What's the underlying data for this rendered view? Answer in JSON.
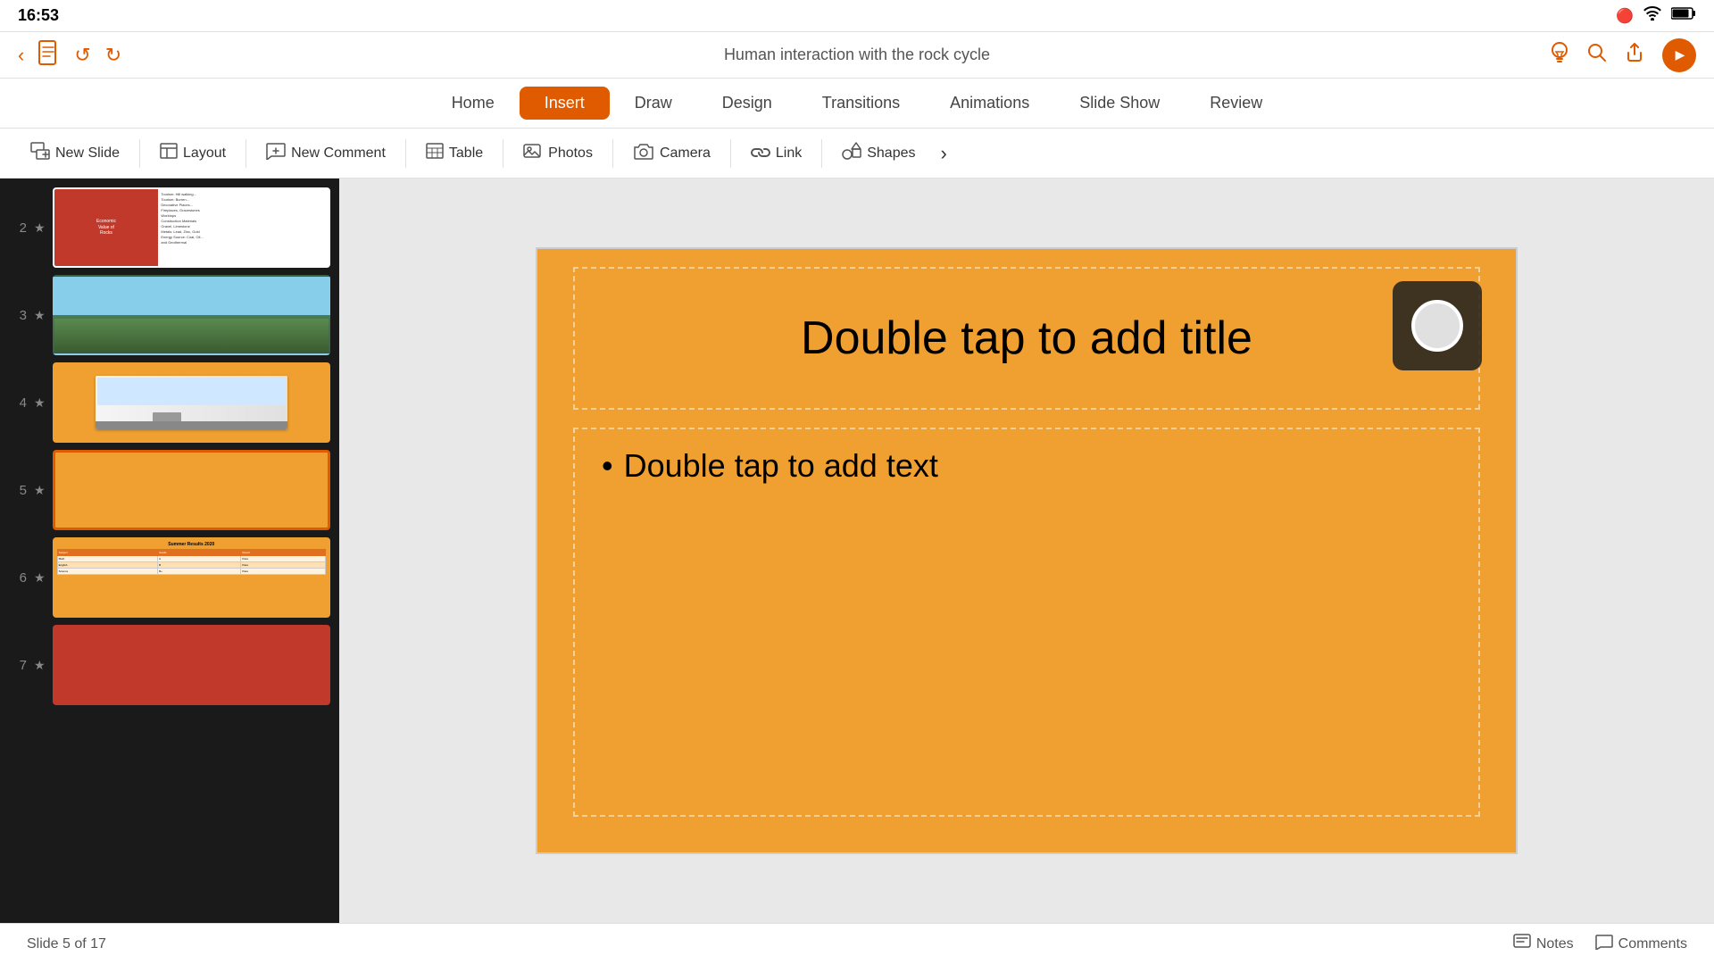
{
  "statusBar": {
    "time": "16:53",
    "icons": [
      "record",
      "wifi",
      "battery"
    ]
  },
  "titleBar": {
    "title": "Human interaction with the rock cycle"
  },
  "tabs": [
    {
      "label": "Home",
      "active": false
    },
    {
      "label": "Insert",
      "active": true
    },
    {
      "label": "Draw",
      "active": false
    },
    {
      "label": "Design",
      "active": false
    },
    {
      "label": "Transitions",
      "active": false
    },
    {
      "label": "Animations",
      "active": false
    },
    {
      "label": "Slide Show",
      "active": false
    },
    {
      "label": "Review",
      "active": false
    }
  ],
  "toolbar": [
    {
      "label": "New Slide",
      "icon": "new-slide"
    },
    {
      "label": "Layout",
      "icon": "layout"
    },
    {
      "label": "New Comment",
      "icon": "new-comment"
    },
    {
      "label": "Table",
      "icon": "table"
    },
    {
      "label": "Photos",
      "icon": "photos"
    },
    {
      "label": "Camera",
      "icon": "camera"
    },
    {
      "label": "Link",
      "icon": "link"
    },
    {
      "label": "Shapes",
      "icon": "shapes"
    }
  ],
  "slides": [
    {
      "number": "2",
      "star": true,
      "type": "content"
    },
    {
      "number": "3",
      "star": true,
      "type": "photo"
    },
    {
      "number": "4",
      "star": true,
      "type": "laptop"
    },
    {
      "number": "5",
      "star": true,
      "type": "blank",
      "active": true
    },
    {
      "number": "6",
      "star": true,
      "type": "table"
    },
    {
      "number": "7",
      "star": true,
      "type": "red"
    }
  ],
  "currentSlide": {
    "titlePlaceholder": "Double tap to add title",
    "contentPlaceholder": "Double tap to add text",
    "background": "#f0a030"
  },
  "bottomBar": {
    "slideCount": "Slide 5 of 17",
    "notes": "Notes",
    "comments": "Comments"
  }
}
